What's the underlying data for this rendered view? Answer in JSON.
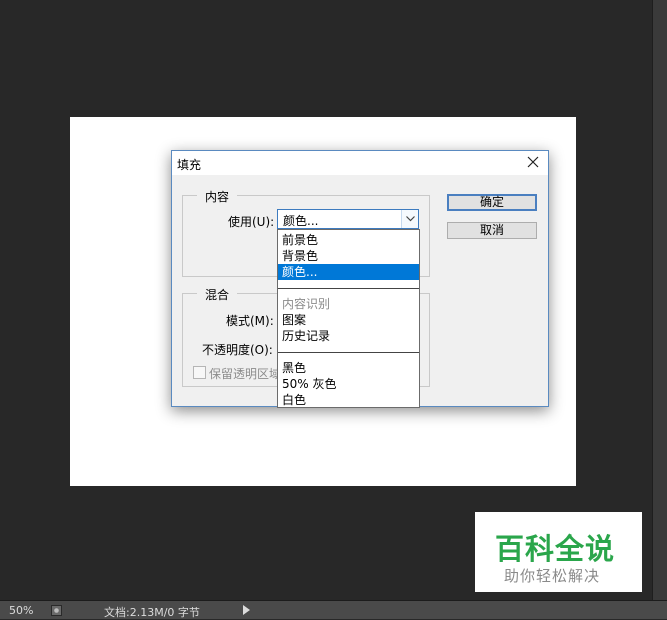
{
  "dialog": {
    "title": "填充",
    "content_group": "内容",
    "use_label": "使用(U):",
    "use_value": "颜色...",
    "blend_group": "混合",
    "mode_label": "模式(M):",
    "opacity_label": "不透明度(O):",
    "preserve_label": "保留透明区域",
    "ok_label": "确定",
    "cancel_label": "取消"
  },
  "dropdown": {
    "options": [
      "前景色",
      "背景色",
      "颜色...",
      "内容识别",
      "图案",
      "历史记录",
      "黑色",
      "50% 灰色",
      "白色"
    ],
    "selected": "颜色...",
    "disabled": [
      "内容识别"
    ]
  },
  "watermark": {
    "main": "百科全说",
    "sub": "助你轻松解决"
  },
  "status": {
    "zoom": "50%",
    "doc_info": "文档:2.13M/0 字节"
  },
  "colors": {
    "workspace": "#282828",
    "selection": "#0078d7",
    "watermark_green": "#2aa64b"
  },
  "icons": [
    "close-icon",
    "chevron-down-icon",
    "status-info-icon",
    "play-arrow-icon"
  ]
}
